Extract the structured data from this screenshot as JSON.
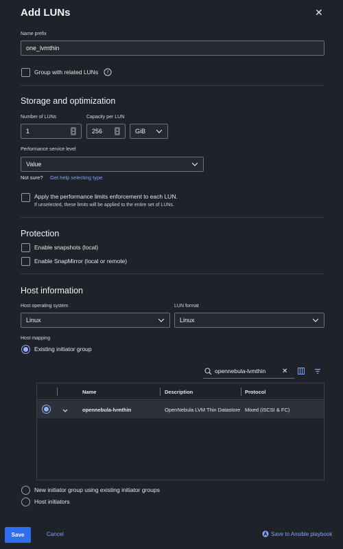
{
  "dialog": {
    "title": "Add LUNs",
    "close_icon": "close-icon"
  },
  "name_prefix": {
    "label": "Name prefix",
    "value": "one_lvmthin"
  },
  "group": {
    "label": "Group with related LUNs",
    "help_icon": "help-circle-icon",
    "checked": false
  },
  "storage": {
    "heading": "Storage and optimization",
    "num_luns_label": "Number of LUNs",
    "num_luns_value": "1",
    "capacity_label": "Capacity per LUN",
    "capacity_value": "256",
    "capacity_unit": "GiB",
    "perf_label": "Performance service level",
    "perf_value": "Value",
    "not_sure": "Not sure?",
    "help_link": "Get help selecting type",
    "apply_label": "Apply the performance limits enforcement to each LUN.",
    "apply_sub": "If unselected, these limits will be applied to the entire set of LUNs."
  },
  "protection": {
    "heading": "Protection",
    "snapshots_label": "Enable snapshots (local)",
    "snapmirror_label": "Enable SnapMirror (local or remote)"
  },
  "host": {
    "heading": "Host information",
    "os_label": "Host operating system",
    "os_value": "Linux",
    "format_label": "LUN format",
    "format_value": "Linux",
    "mapping_label": "Host mapping",
    "existing_group_label": "Existing initiator group",
    "search_value": "opennebula-lvmthin",
    "new_group_label": "New initiator group using existing initiator groups",
    "host_initiators_label": "Host initiators"
  },
  "table": {
    "columns": [
      "Name",
      "Description",
      "Protocol"
    ],
    "rows": [
      {
        "name": "opennebula-lvmthin",
        "description": "OpenNebula LVM Thin Datastore",
        "protocol": "Mixed (iSCSI & FC)",
        "selected": true
      }
    ]
  },
  "footer": {
    "save": "Save",
    "cancel": "Cancel",
    "ansible": "Save to Ansible playbook"
  },
  "colors": {
    "accent": "#2f6ef2",
    "link": "#7ea3ff",
    "background": "#1f2229"
  }
}
